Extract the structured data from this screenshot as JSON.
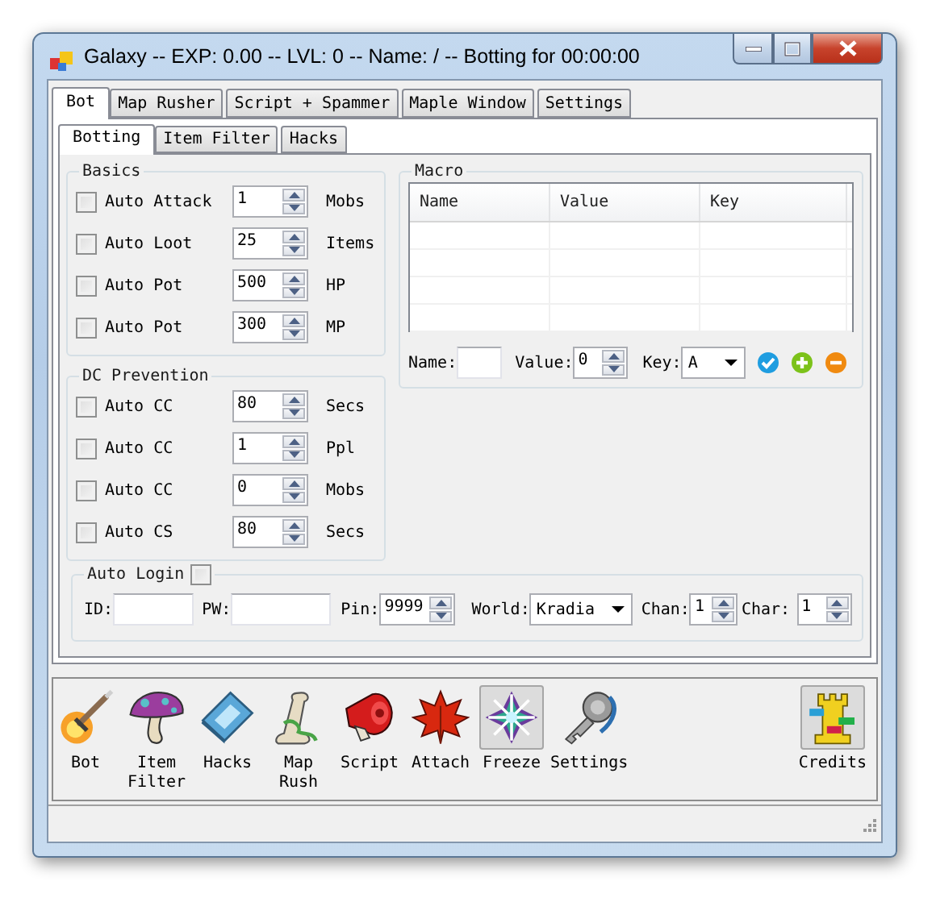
{
  "window": {
    "title": "Galaxy -- EXP: 0.00 -- LVL: 0 -- Name: / -- Botting for 00:00:00"
  },
  "tabs": [
    {
      "label": "Bot",
      "selected": true
    },
    {
      "label": "Map Rusher",
      "selected": false
    },
    {
      "label": "Script + Spammer",
      "selected": false
    },
    {
      "label": "Maple Window",
      "selected": false
    },
    {
      "label": "Settings",
      "selected": false
    }
  ],
  "subtabs": [
    {
      "label": "Botting",
      "selected": true
    },
    {
      "label": "Item Filter",
      "selected": false
    },
    {
      "label": "Hacks",
      "selected": false
    }
  ],
  "groups": [
    {
      "title": "Basics",
      "rows": [
        {
          "label": "Auto Attack",
          "checked": false,
          "value": "1",
          "unit": "Mobs"
        },
        {
          "label": "Auto Loot",
          "checked": false,
          "value": "25",
          "unit": "Items"
        },
        {
          "label": "Auto Pot",
          "checked": false,
          "value": "500",
          "unit": "HP"
        },
        {
          "label": "Auto Pot",
          "checked": false,
          "value": "300",
          "unit": "MP"
        }
      ]
    },
    {
      "title": "DC Prevention",
      "rows": [
        {
          "label": "Auto CC",
          "checked": false,
          "value": "80",
          "unit": "Secs"
        },
        {
          "label": "Auto CC",
          "checked": false,
          "value": "1",
          "unit": "Ppl"
        },
        {
          "label": "Auto CC",
          "checked": false,
          "value": "0",
          "unit": "Mobs"
        },
        {
          "label": "Auto CS",
          "checked": false,
          "value": "80",
          "unit": "Secs"
        }
      ]
    }
  ],
  "macro": {
    "title": "Macro",
    "columns": [
      "Name",
      "Value",
      "Key"
    ],
    "name_label": "Name:",
    "value_label": "Value:",
    "value": "0",
    "key_label": "Key:",
    "key": "A"
  },
  "auto_login": {
    "label": "Auto Login",
    "checked": false,
    "id_label": "ID:",
    "pw_label": "PW:",
    "pin_label": "Pin:",
    "pin": "9999",
    "world_label": "World:",
    "world": "Kradia",
    "chan_label": "Chan:",
    "chan": "1",
    "char_label": "Char:",
    "char": "1"
  },
  "toolbar": {
    "items": [
      {
        "label": "Bot",
        "kind": "bot",
        "selected": false
      },
      {
        "label": "Item Filter",
        "kind": "mushroom",
        "selected": false
      },
      {
        "label": "Hacks",
        "kind": "card",
        "selected": false
      },
      {
        "label": "Map Rush",
        "kind": "scroll",
        "selected": false
      },
      {
        "label": "Script",
        "kind": "megaphone",
        "selected": false
      },
      {
        "label": "Attach",
        "kind": "leaf",
        "selected": false
      },
      {
        "label": "Freeze",
        "kind": "snowflake",
        "selected": true
      },
      {
        "label": "Settings",
        "kind": "key",
        "selected": false
      }
    ],
    "right_items": [
      {
        "label": "Credits",
        "kind": "tower",
        "selected": true
      }
    ]
  }
}
